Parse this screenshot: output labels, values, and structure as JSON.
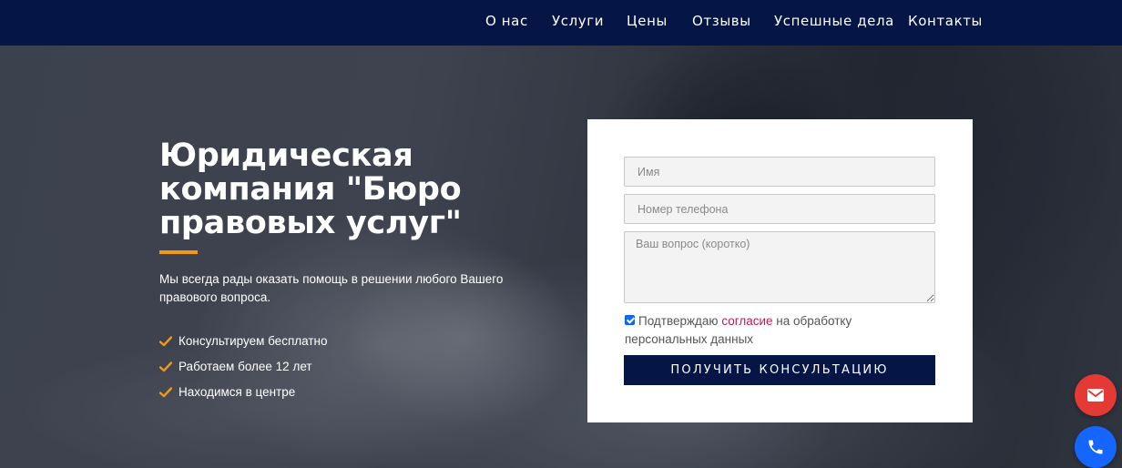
{
  "nav": {
    "items": [
      {
        "label": "О нас"
      },
      {
        "label": "Услуги"
      },
      {
        "label": "Цены"
      },
      {
        "label": "Отзывы"
      },
      {
        "label": "Успешные дела"
      },
      {
        "label": "Контакты"
      }
    ]
  },
  "hero": {
    "title_line1": "Юридическая",
    "title_line2": "компания \"Бюро",
    "title_line3": "правовых услуг\"",
    "description": "Мы всегда рады оказать помощь в решении любого Вашего правового вопроса.",
    "features": [
      {
        "label": "Консультируем бесплатно"
      },
      {
        "label": "Работаем более 12 лет"
      },
      {
        "label": "Находимся в центре"
      }
    ]
  },
  "form": {
    "name_placeholder": "Имя",
    "phone_placeholder": "Номер телефона",
    "question_placeholder": "Ваш вопрос (коротко)",
    "consent_prefix": "Подтверждаю ",
    "consent_link": "согласие",
    "consent_suffix": " на обработку персональных данных",
    "submit_label": "ПОЛУЧИТЬ КОНСУЛЬТАЦИЮ"
  },
  "colors": {
    "nav_bg": "#041546",
    "accent": "#f39a14",
    "link": "#c2185b",
    "mail_button": "#e53935",
    "phone_button": "#1565ff"
  },
  "icons": {
    "feature": "check-icon",
    "mail": "mail-icon",
    "phone": "phone-icon"
  }
}
